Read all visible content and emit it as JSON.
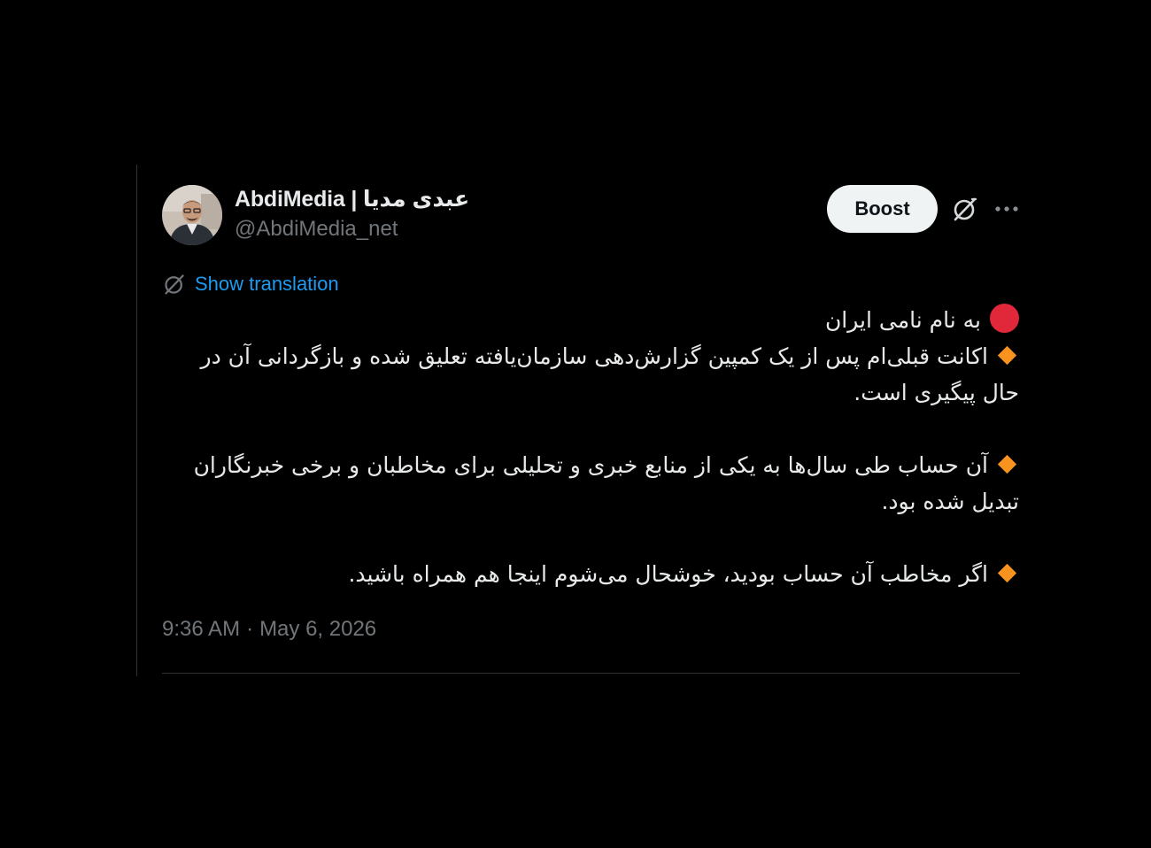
{
  "author": {
    "display_name": "AbdiMedia | عبدی مدیا",
    "handle": "@AbdiMedia_net",
    "avatar_icon": "profile-photo"
  },
  "actions": {
    "boost_label": "Boost",
    "grok_icon": "grok-icon",
    "more_icon": "more-icon"
  },
  "translation": {
    "label": "Show translation",
    "icon": "grok-translate-icon"
  },
  "body": {
    "line1": "به نام نامی ایران",
    "para1": "اکانت قبلی‌ام پس از یک کمپین گزارش‌دهی سازمان‌یافته تعلیق شده و بازگردانی آن در حال پیگیری است.",
    "para2": "آن حساب طی سال‌ها به یکی از منابع خبری و تحلیلی برای مخاطبان و برخی خبرنگاران تبدیل شده بود.",
    "para3": "اگر مخاطب آن حساب بودید، خوشحال می‌شوم اینجا هم همراه باشید."
  },
  "meta": {
    "time": "9:36 AM",
    "separator": "·",
    "date": "May 6, 2026"
  },
  "colors": {
    "background": "#000000",
    "text": "#e7e9ea",
    "muted": "#71767b",
    "link": "#1d9bf0",
    "red_marker": "#e0283a",
    "diamond_marker": "#f7931e"
  }
}
